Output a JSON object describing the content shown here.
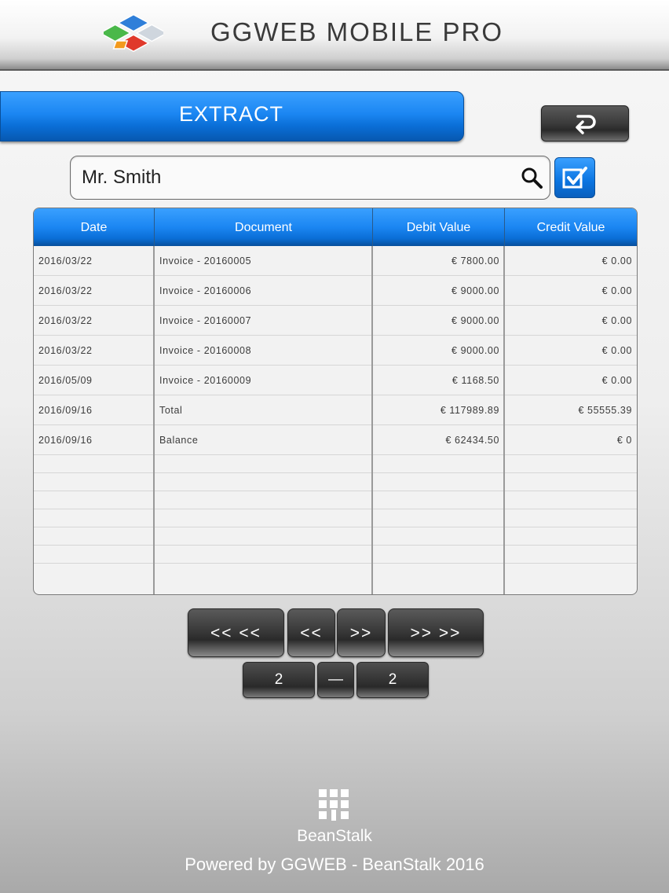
{
  "header": {
    "title": "GGWEB MOBILE PRO"
  },
  "extract": {
    "label": "EXTRACT"
  },
  "search": {
    "value": "Mr. Smith"
  },
  "table": {
    "columns": [
      "Date",
      "Document",
      "Debit Value",
      "Credit Value"
    ],
    "rows": [
      {
        "date": "2016/03/22",
        "document": "Invoice - 20160005",
        "debit": "€ 7800.00",
        "credit": "€ 0.00"
      },
      {
        "date": "2016/03/22",
        "document": "Invoice - 20160006",
        "debit": "€ 9000.00",
        "credit": "€ 0.00"
      },
      {
        "date": "2016/03/22",
        "document": "Invoice - 20160007",
        "debit": "€ 9000.00",
        "credit": "€ 0.00"
      },
      {
        "date": "2016/03/22",
        "document": "Invoice - 20160008",
        "debit": "€ 9000.00",
        "credit": "€ 0.00"
      },
      {
        "date": "2016/05/09",
        "document": "Invoice - 20160009",
        "debit": "€ 1168.50",
        "credit": "€ 0.00"
      },
      {
        "date": "2016/09/16",
        "document": "Total",
        "debit": "€ 117989.89",
        "credit": "€ 55555.39"
      },
      {
        "date": "2016/09/16",
        "document": "Balance",
        "debit": "€ 62434.50",
        "credit": "€ 0"
      }
    ]
  },
  "pagination": {
    "first": "<< <<",
    "prev": "<<",
    "next": ">>",
    "last": ">> >>",
    "current_page": "2",
    "separator": "—",
    "total_pages": "2"
  },
  "footer": {
    "brand": "BeanStalk",
    "powered_by": "Powered by GGWEB - BeanStalk 2016"
  },
  "icons": {
    "logo": "ggweb-logo-icon",
    "back": "return-arrow-icon",
    "search": "search-icon",
    "check": "checkbox-checked-icon",
    "brand": "beanstalk-logo-icon"
  },
  "colors": {
    "accent_blue": "#1b86f2",
    "dark_button": "#3a3a3a"
  }
}
